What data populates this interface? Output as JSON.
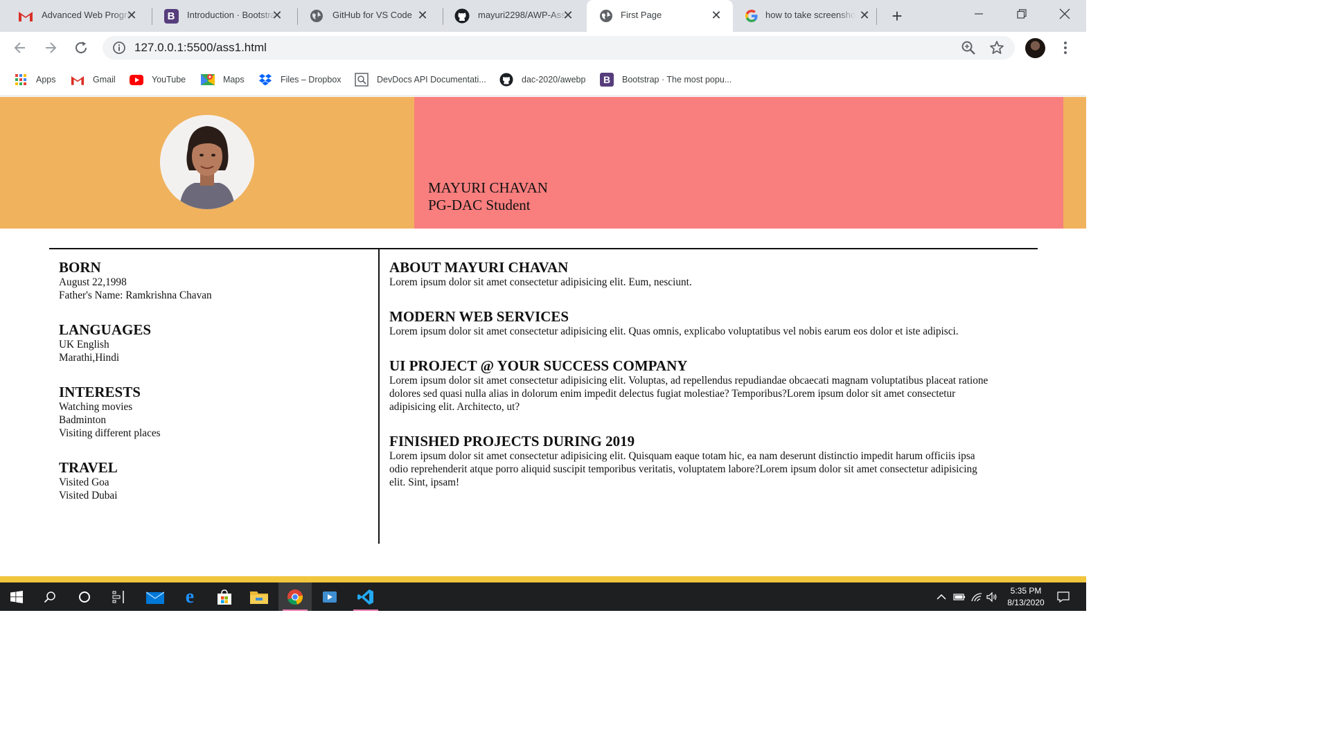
{
  "tabs": [
    {
      "title": "Advanced Web Progra",
      "favicon": "gmail-icon"
    },
    {
      "title": "Introduction · Bootstra",
      "favicon": "bootstrap-icon"
    },
    {
      "title": "GitHub for VS Code",
      "favicon": "globe-icon"
    },
    {
      "title": "mayuri2298/AWP-Assi",
      "favicon": "github-icon"
    },
    {
      "title": "First Page",
      "favicon": "globe-icon",
      "active": true
    },
    {
      "title": "how to take screensho",
      "favicon": "google-icon"
    }
  ],
  "address_bar": {
    "url": "127.0.0.1:5500/ass1.html"
  },
  "bookmarks": [
    {
      "label": "Apps",
      "icon": "apps-grid-icon"
    },
    {
      "label": "Gmail",
      "icon": "gmail-icon"
    },
    {
      "label": "YouTube",
      "icon": "youtube-icon"
    },
    {
      "label": "Maps",
      "icon": "maps-icon"
    },
    {
      "label": "Files – Dropbox",
      "icon": "dropbox-icon"
    },
    {
      "label": "DevDocs API Documentati...",
      "icon": "devdocs-icon"
    },
    {
      "label": "dac-2020/awebp",
      "icon": "github-icon"
    },
    {
      "label": "Bootstrap · The most popu...",
      "icon": "bootstrap-icon"
    }
  ],
  "hero": {
    "name": "MAYURI CHAVAN",
    "role": "PG-DAC Student",
    "left_color": "#f0b25d",
    "right_color": "#f97e7e"
  },
  "left_column": [
    {
      "heading": "BORN",
      "lines": [
        "August 22,1998",
        "Father's Name: Ramkrishna Chavan"
      ]
    },
    {
      "heading": "LANGUAGES",
      "lines": [
        "UK English",
        "Marathi,Hindi"
      ]
    },
    {
      "heading": "INTERESTS",
      "lines": [
        "Watching movies",
        "Badminton",
        "Visiting different places"
      ]
    },
    {
      "heading": "TRAVEL",
      "lines": [
        "Visited Goa",
        "Visited Dubai"
      ]
    }
  ],
  "right_column": [
    {
      "heading": "ABOUT MAYURI CHAVAN",
      "lines": [
        "Lorem ipsum dolor sit amet consectetur adipisicing elit. Eum, nesciunt."
      ]
    },
    {
      "heading": "MODERN WEB SERVICES",
      "lines": [
        "Lorem ipsum dolor sit amet consectetur adipisicing elit. Quas omnis, explicabo voluptatibus vel nobis earum eos dolor et iste adipisci."
      ]
    },
    {
      "heading": "UI PROJECT @ YOUR SUCCESS COMPANY",
      "lines": [
        "Lorem ipsum dolor sit amet consectetur adipisicing elit. Voluptas, ad repellendus repudiandae obcaecati magnam voluptatibus placeat ratione",
        "dolores sed quasi nulla alias in dolorum enim impedit delectus fugiat molestiae? Temporibus?Lorem ipsum dolor sit amet consectetur",
        "adipisicing elit. Architecto, ut?"
      ]
    },
    {
      "heading": "FINISHED PROJECTS DURING 2019",
      "lines": [
        "Lorem ipsum dolor sit amet consectetur adipisicing elit. Quisquam eaque totam hic, ea nam deserunt distinctio impedit harum officiis ipsa",
        "odio reprehenderit atque porro aliquid suscipit temporibus veritatis, voluptatem labore?Lorem ipsum dolor sit amet consectetur adipisicing",
        "elit. Sint, ipsam!"
      ]
    }
  ],
  "taskbar": {
    "apps": [
      "windows-start-icon",
      "search-icon",
      "cortana-icon",
      "task-view-icon",
      "mail-icon",
      "edge-icon",
      "store-icon",
      "file-explorer-icon",
      "chrome-icon",
      "media-player-icon",
      "vscode-icon"
    ],
    "time": "5:35 PM",
    "date": "8/13/2020"
  }
}
